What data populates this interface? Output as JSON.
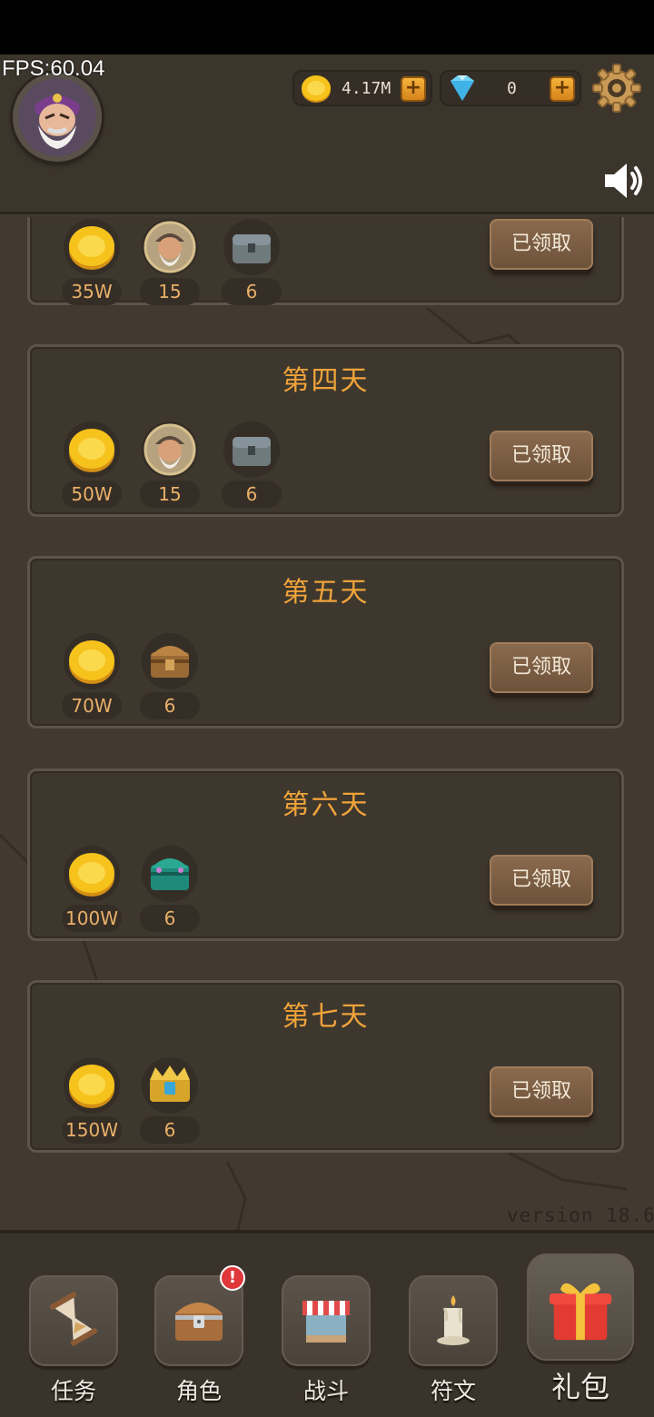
{
  "fps_counter": "FPS:60.04",
  "header": {
    "gold_amount": "4.17M",
    "gem_amount": "0",
    "add_symbol": "+"
  },
  "rewards": {
    "day3": {
      "gold": "35W",
      "hero": "15",
      "chest": "6"
    },
    "day4": {
      "title": "第四天",
      "gold": "50W",
      "hero": "15",
      "chest": "6"
    },
    "day5": {
      "title": "第五天",
      "gold": "70W",
      "chest": "6"
    },
    "day6": {
      "title": "第六天",
      "gold": "100W",
      "chest": "6"
    },
    "day7": {
      "title": "第七天",
      "gold": "150W",
      "chest": "6"
    }
  },
  "claimed_label": "已领取",
  "version": "version 18.6",
  "nav": {
    "tasks": "任务",
    "character": "角色",
    "battle": "战斗",
    "runes": "符文",
    "gift": "礼包",
    "badge": "!"
  },
  "colors": {
    "background": "#423a30",
    "title_orange": "#efa33a",
    "quantity_text": "#e9b06a",
    "button_brown": "#7c5e43",
    "badge_red": "#e0373b"
  },
  "icons": [
    "gear-icon",
    "sound-icon",
    "gold-coin-icon",
    "gem-icon",
    "hero-portrait-icon",
    "stone-chest-icon",
    "wooden-chest-icon",
    "jade-chest-icon",
    "golden-chest-icon",
    "hourglass-icon",
    "treasure-chest-icon",
    "shop-stall-icon",
    "candle-icon",
    "gift-box-icon"
  ]
}
